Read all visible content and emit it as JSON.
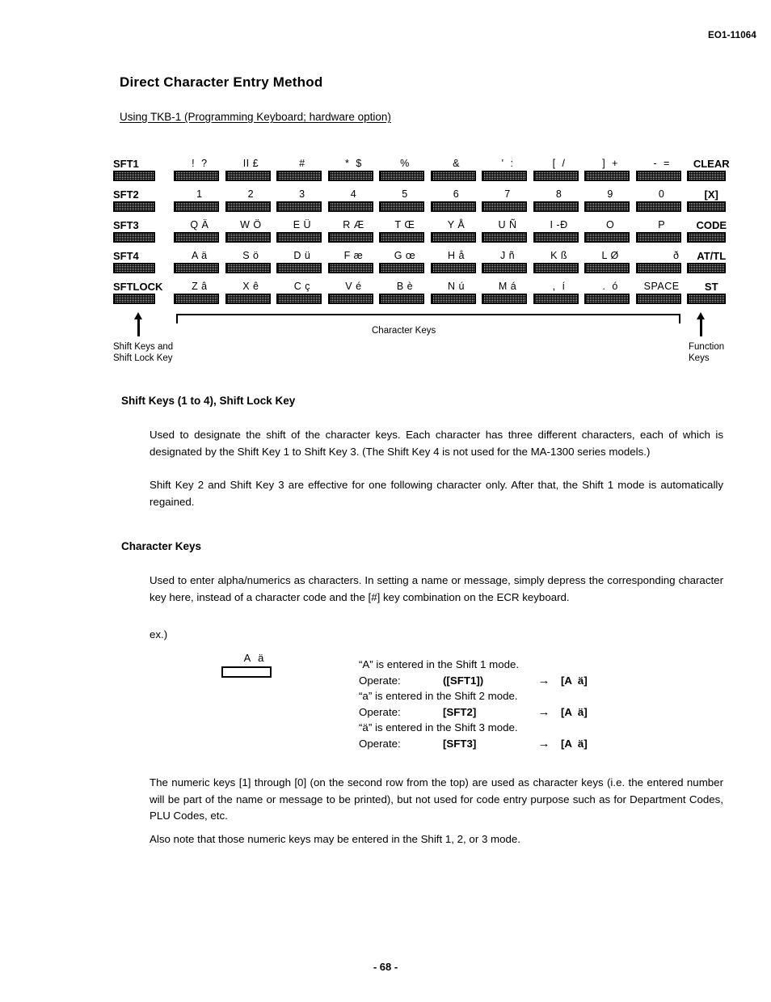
{
  "header": {
    "doc_code": "EO1-11064"
  },
  "title": "Direct Character Entry Method",
  "subtitle": "Using TKB-1 (Programming Keyboard; hardware option)",
  "keyboard": {
    "rows": [
      {
        "shift_label": "SFT1",
        "keys": [
          "!  ?",
          "II £",
          "#",
          "*  $",
          "%",
          "&",
          "'  :",
          "[  /",
          "]  +",
          "-  ="
        ],
        "fn_label": "CLEAR"
      },
      {
        "shift_label": "SFT2",
        "keys": [
          "1",
          "2",
          "3",
          "4",
          "5",
          "6",
          "7",
          "8",
          "9",
          "0"
        ],
        "fn_label": "[X]"
      },
      {
        "shift_label": "SFT3",
        "keys": [
          "Q Ä",
          "W Ö",
          "E Ü",
          "R Æ",
          "T Œ",
          "Y Å",
          "U Ñ",
          "I -Ð",
          "O",
          "P"
        ],
        "fn_label": "CODE"
      },
      {
        "shift_label": "SFT4",
        "keys": [
          "A ä",
          "S ö",
          "D ü",
          "F æ",
          "G œ",
          "H å",
          "J ñ",
          "K ß",
          "L Ø",
          "ð"
        ],
        "fn_label": "AT/TL"
      },
      {
        "shift_label": "SFTLOCK",
        "keys": [
          "Z â",
          "X ê",
          "C ç",
          "V é",
          "B è",
          "N ú",
          "M á",
          ",  í",
          ".  ó",
          "SPACE"
        ],
        "fn_label": "ST"
      }
    ],
    "annotations": {
      "shift_keys": "Shift Keys  and\nShift Lock Key",
      "character_keys": "Character Keys",
      "function_keys": "Function\nKeys"
    }
  },
  "sections": {
    "shift": {
      "heading": "Shift Keys (1 to 4), Shift Lock Key",
      "paragraph_1": "Used to designate the shift of the character keys.  Each character has three different characters, each of which is designated by the Shift Key 1 to Shift Key 3.  (The Shift Key 4 is not used for the MA-1300 series models.)",
      "paragraph_2": "Shift Key 2 and Shift Key 3 are effective for one following character only.  After that, the Shift 1 mode is automatically regained."
    },
    "character": {
      "heading": "Character Keys",
      "paragraph_1": "Used to enter alpha/numerics as characters.  In setting a name or message, simply depress the corresponding character key here, instead of a character code and the [#] key combination on the ECR keyboard.",
      "example_label": "ex.)",
      "example_key_legend": "A ä",
      "example_lines": [
        {
          "description": "“A” is entered in the Shift 1 mode.",
          "operate_label": "Operate:",
          "operate_key": "([SFT1])",
          "arrow": "→",
          "operate_target": "[A  ä]"
        },
        {
          "description": "“a” is entered in the Shift 2 mode.",
          "operate_label": "Operate:",
          "operate_key": "[SFT2]",
          "arrow": "→",
          "operate_target": "[A  ä]"
        },
        {
          "description": "“ä” is entered in the Shift 3 mode.",
          "operate_label": "Operate:",
          "operate_key": "[SFT3]",
          "arrow": "→",
          "operate_target": "[A  ä]"
        }
      ],
      "paragraph_numeric_1": "The numeric keys [1] through [0] (on the second row from the top) are used as character keys (i.e. the entered number will be part of the name or message to be printed), but not used for code entry purpose such as for Department Codes, PLU Codes, etc.",
      "paragraph_numeric_2": "Also note that those numeric keys may be entered in the Shift 1, 2, or 3 mode."
    }
  },
  "footer": {
    "page_number": "- 68 -"
  }
}
